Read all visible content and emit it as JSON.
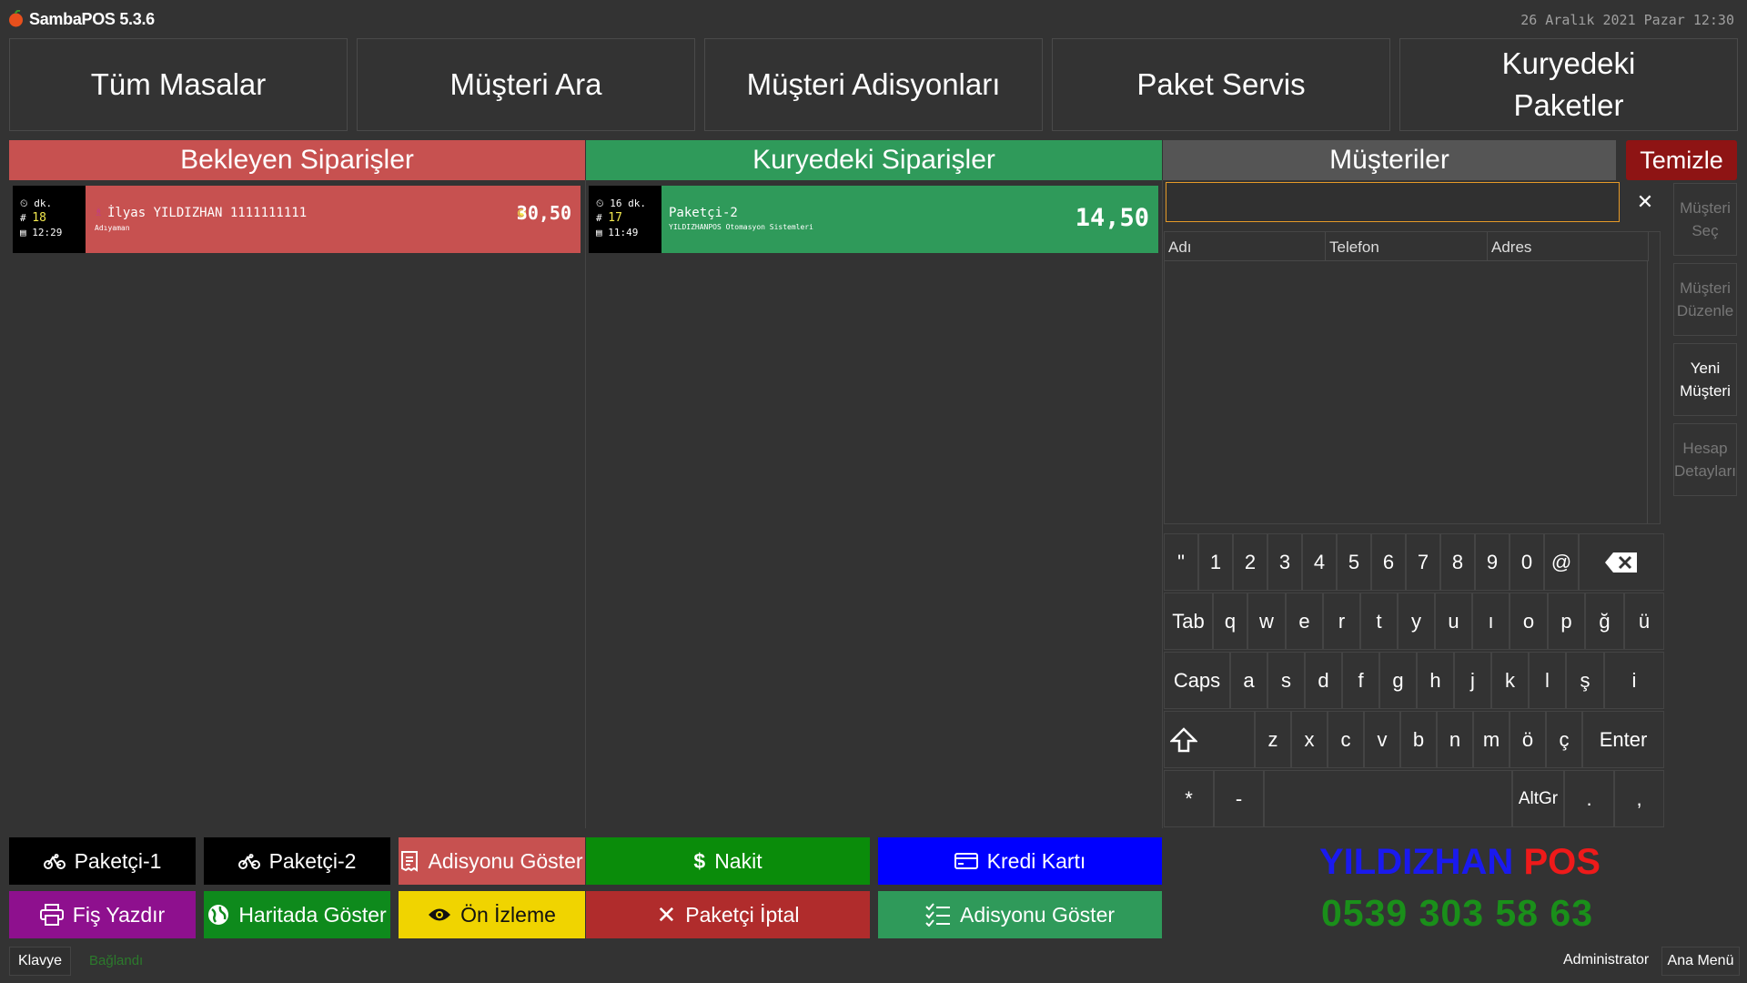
{
  "app": {
    "title": "SambaPOS 5.3.6",
    "datetime": "26 Aralık 2021 Pazar 12:30"
  },
  "nav": {
    "all_tables": "Tüm Masalar",
    "search_customer": "Müşteri Ara",
    "customer_tickets": "Müşteri Adisyonları",
    "delivery_service": "Paket Servis",
    "courier_packages_l1": "Kuryedeki",
    "courier_packages_l2": "Paketler"
  },
  "sections": {
    "pending": "Bekleyen Siparişler",
    "on_courier": "Kuryedeki Siparişler",
    "customers": "Müşteriler",
    "clear": "Temizle"
  },
  "pending_orders": [
    {
      "minutes": "dk.",
      "number": "18",
      "time": "12:29",
      "customer": "İlyas YILDIZHAN 1111111111",
      "city": "Adıyaman",
      "amount": "30,50"
    }
  ],
  "courier_orders": [
    {
      "minutes": "16 dk.",
      "number": "17",
      "time": "11:49",
      "courier": "Paketçi-2",
      "company": "YILDIZHANPOS Otomasyon Sistemleri",
      "amount": "14,50"
    }
  ],
  "search": {
    "value": "",
    "placeholder": ""
  },
  "customer_table": {
    "columns": [
      "Adı",
      "Telefon",
      "Adres"
    ]
  },
  "side_buttons": {
    "select_l1": "Müşteri",
    "select_l2": "Seç",
    "edit_l1": "Müşteri",
    "edit_l2": "Düzenle",
    "new_l1": "Yeni",
    "new_l2": "Müşteri",
    "account_l1": "Hesap",
    "account_l2": "Detayları"
  },
  "keyboard": {
    "row1": [
      "\"",
      "1",
      "2",
      "3",
      "4",
      "5",
      "6",
      "7",
      "8",
      "9",
      "0",
      "@"
    ],
    "row2": [
      "Tab",
      "q",
      "w",
      "e",
      "r",
      "t",
      "y",
      "u",
      "ı",
      "o",
      "p",
      "ğ",
      "ü"
    ],
    "row3": [
      "Caps",
      "a",
      "s",
      "d",
      "f",
      "g",
      "h",
      "j",
      "k",
      "l",
      "ş",
      "i"
    ],
    "row4": [
      "z",
      "x",
      "c",
      "v",
      "b",
      "n",
      "m",
      "ö",
      "ç",
      "Enter"
    ],
    "row5": [
      "*",
      "-",
      "AltGr",
      ".",
      ","
    ]
  },
  "actions": {
    "courier1": "Paketçi-1",
    "courier2": "Paketçi-2",
    "show_ticket": "Adisyonu Göster",
    "cash": "Nakit",
    "credit_card": "Kredi Kartı",
    "print_receipt": "Fiş Yazdır",
    "show_map": "Haritada Göster",
    "preview": "Ön İzleme",
    "cancel_courier": "Paketçi İptal",
    "show_ticket_2": "Adisyonu Göster"
  },
  "brand": {
    "name_a": "YILDIZHAN",
    "name_b": "POS",
    "phone": "0539 303 58 63"
  },
  "status": {
    "keyboard": "Klavye",
    "connection": "Bağlandı",
    "user": "Administrator",
    "main_menu": "Ana Menü"
  },
  "colors": {
    "pending": "#c75150",
    "courier": "#2f9a5a",
    "customers_header": "#555555",
    "clear": "#8e1414",
    "cash": "#0a8c0a",
    "credit": "#0000ff",
    "print": "#8e108e",
    "map": "#0e8a1c",
    "preview": "#f0d400",
    "cancel": "#b02c2c",
    "show_ticket_green": "#2f9a5a"
  }
}
